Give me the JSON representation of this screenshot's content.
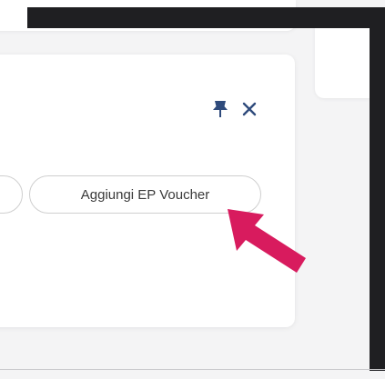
{
  "panel": {
    "voucher_button_label": "Aggiungi EP Voucher",
    "icons": {
      "pin": "pin-icon",
      "close": "close-icon"
    }
  },
  "colors": {
    "icon": "#2f4b7c",
    "annotation_arrow": "#d81b5e",
    "background": "#f4f4f5",
    "dark_frame": "#1f1f22"
  }
}
